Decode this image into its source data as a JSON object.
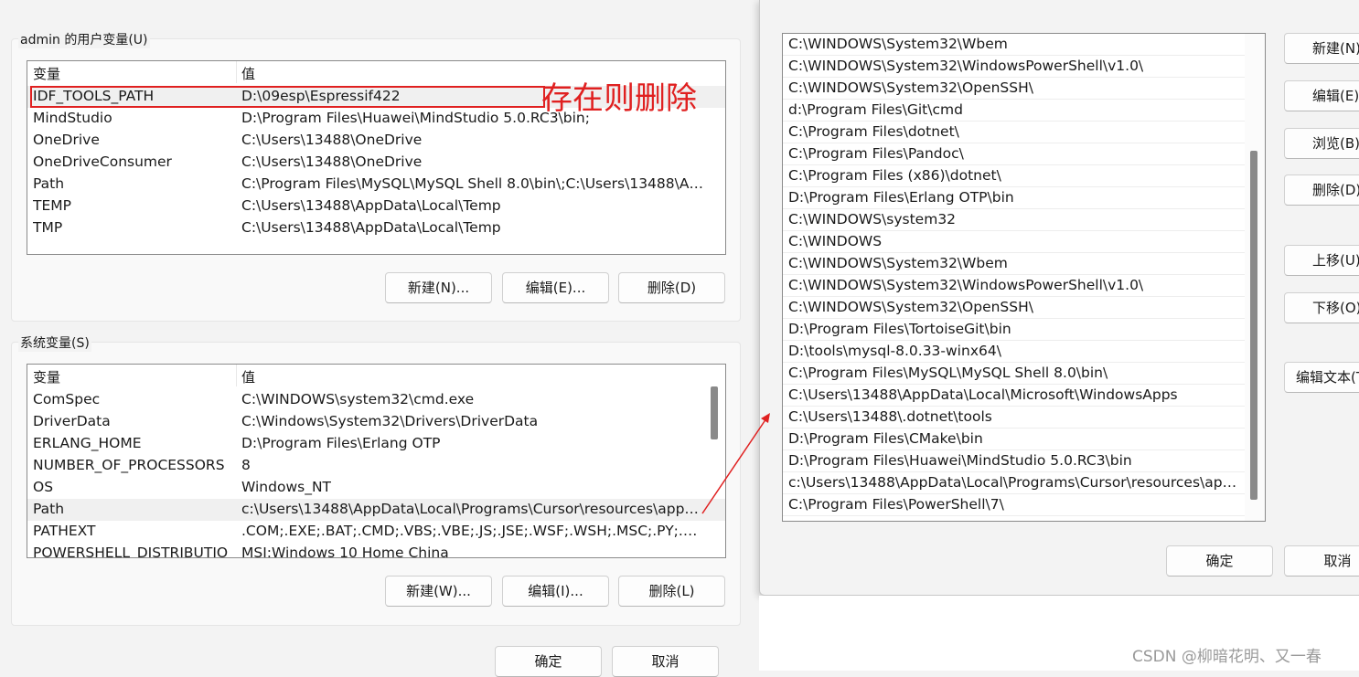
{
  "user_vars": {
    "title": "admin 的用户变量(U)",
    "col_var": "变量",
    "col_val": "值",
    "rows": [
      {
        "name": "IDF_TOOLS_PATH",
        "value": "D:\\09esp\\Espressif422"
      },
      {
        "name": "MindStudio",
        "value": "D:\\Program Files\\Huawei\\MindStudio 5.0.RC3\\bin;"
      },
      {
        "name": "OneDrive",
        "value": "C:\\Users\\13488\\OneDrive"
      },
      {
        "name": "OneDriveConsumer",
        "value": "C:\\Users\\13488\\OneDrive"
      },
      {
        "name": "Path",
        "value": "C:\\Program Files\\MySQL\\MySQL Shell 8.0\\bin\\;C:\\Users\\13488\\Ap..."
      },
      {
        "name": "TEMP",
        "value": "C:\\Users\\13488\\AppData\\Local\\Temp"
      },
      {
        "name": "TMP",
        "value": "C:\\Users\\13488\\AppData\\Local\\Temp"
      }
    ],
    "btn_new": "新建(N)...",
    "btn_edit": "编辑(E)...",
    "btn_delete": "删除(D)"
  },
  "annotation": "存在则删除",
  "sys_vars": {
    "title": "系统变量(S)",
    "col_var": "变量",
    "col_val": "值",
    "rows": [
      {
        "name": "ComSpec",
        "value": "C:\\WINDOWS\\system32\\cmd.exe"
      },
      {
        "name": "DriverData",
        "value": "C:\\Windows\\System32\\Drivers\\DriverData"
      },
      {
        "name": "ERLANG_HOME",
        "value": "D:\\Program Files\\Erlang OTP"
      },
      {
        "name": "NUMBER_OF_PROCESSORS",
        "value": "8"
      },
      {
        "name": "OS",
        "value": "Windows_NT"
      },
      {
        "name": "Path",
        "value": "c:\\Users\\13488\\AppData\\Local\\Programs\\Cursor\\resources\\app\\bi..."
      },
      {
        "name": "PATHEXT",
        "value": ".COM;.EXE;.BAT;.CMD;.VBS;.VBE;.JS;.JSE;.WSF;.WSH;.MSC;.PY;.PYW"
      },
      {
        "name": "POWERSHELL_DISTRIBUTIO",
        "value": "MSI:Windows 10 Home China"
      }
    ],
    "btn_new": "新建(W)...",
    "btn_edit": "编辑(I)...",
    "btn_delete": "删除(L)"
  },
  "left_ok": "确定",
  "left_cancel": "取消",
  "path_editor": {
    "entries": [
      "C:\\WINDOWS\\System32\\Wbem",
      "C:\\WINDOWS\\System32\\WindowsPowerShell\\v1.0\\",
      "C:\\WINDOWS\\System32\\OpenSSH\\",
      "d:\\Program Files\\Git\\cmd",
      "C:\\Program Files\\dotnet\\",
      "C:\\Program Files\\Pandoc\\",
      "C:\\Program Files (x86)\\dotnet\\",
      "D:\\Program Files\\Erlang OTP\\bin",
      "C:\\WINDOWS\\system32",
      "C:\\WINDOWS",
      "C:\\WINDOWS\\System32\\Wbem",
      "C:\\WINDOWS\\System32\\WindowsPowerShell\\v1.0\\",
      "C:\\WINDOWS\\System32\\OpenSSH\\",
      "D:\\Program Files\\TortoiseGit\\bin",
      "D:\\tools\\mysql-8.0.33-winx64\\",
      "C:\\Program Files\\MySQL\\MySQL Shell 8.0\\bin\\",
      "C:\\Users\\13488\\AppData\\Local\\Microsoft\\WindowsApps",
      "C:\\Users\\13488\\.dotnet\\tools",
      "D:\\Program Files\\CMake\\bin",
      "D:\\Program Files\\Huawei\\MindStudio 5.0.RC3\\bin",
      "c:\\Users\\13488\\AppData\\Local\\Programs\\Cursor\\resources\\app\\b...",
      "C:\\Program Files\\PowerShell\\7\\"
    ],
    "btn_new": "新建(N)",
    "btn_edit": "编辑(E)",
    "btn_browse": "浏览(B)...",
    "btn_delete": "删除(D)",
    "btn_up": "上移(U)",
    "btn_down": "下移(O)",
    "btn_edit_text": "编辑文本(T)...",
    "btn_ok": "确定",
    "btn_cancel": "取消"
  },
  "watermark": "CSDN @柳暗花明、又一春",
  "colors": {
    "annotation_red": "#e02020"
  }
}
